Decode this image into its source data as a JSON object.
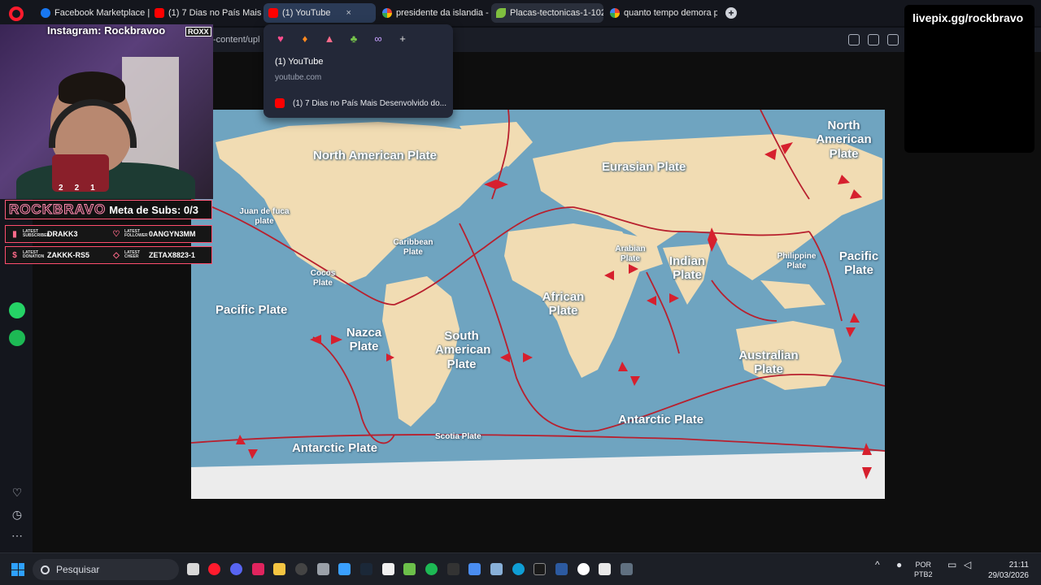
{
  "browser": {
    "tabs": [
      {
        "title": "Facebook Marketplace | Fa",
        "favicon": "facebook-icon"
      },
      {
        "title": "(1) 7 Dias no País Mais De",
        "favicon": "youtube-icon"
      },
      {
        "title": "(1) YouTube",
        "favicon": "youtube-icon",
        "active": true
      },
      {
        "title": "presidente da islandia - Pe",
        "favicon": "google-icon"
      },
      {
        "title": "Placas-tectonicas-1-1024x",
        "favicon": "leaf-icon"
      },
      {
        "title": "quanto tempo demora pa",
        "favicon": "google-icon"
      }
    ],
    "tab_close": "×",
    "new_tab": "+",
    "address_fragment": "-content/upl"
  },
  "tab_popup": {
    "emoji_icons": [
      "heart-icon",
      "fire-icon",
      "poop-icon",
      "palm-tree-icon",
      "glasses-icon"
    ],
    "add": "+",
    "title": "(1) YouTube",
    "url": "youtube.com",
    "item": "(1) 7 Dias no País Mais Desenvolvido do..."
  },
  "stream_overlay": {
    "instagram": "Instagram: Rockbravoo",
    "badge": "ROXX",
    "counters": [
      "2",
      "2",
      "1"
    ],
    "brand": "ROCKBRAVO",
    "goal": "Meta de Subs: 0/3",
    "stats": [
      {
        "label1": "LATEST SUBSCRIBER",
        "value1": "DRAKK3",
        "label2": "LATEST FOLLOWER",
        "value2": "0ANGYN3MM"
      },
      {
        "label1": "LATEST DONATION",
        "value1": "ZAKKK-RS5",
        "label2": "LATEST CHEER",
        "value2": "ZETAX8823-1"
      }
    ],
    "livepix": "livepix.gg/rockbravo"
  },
  "map": {
    "labels": [
      {
        "text": "North American Plate"
      },
      {
        "text": "Eurasian Plate"
      },
      {
        "text": "North American Plate"
      },
      {
        "text": "Juan de fuca plate"
      },
      {
        "text": "Caribbean Plate"
      },
      {
        "text": "Arabian Plate"
      },
      {
        "text": "Indian Plate"
      },
      {
        "text": "Philippine Plate"
      },
      {
        "text": "Pacific Plate"
      },
      {
        "text": "Cocos Plate"
      },
      {
        "text": "African Plate"
      },
      {
        "text": "Pacific Plate"
      },
      {
        "text": "Nazca Plate"
      },
      {
        "text": "South American Plate"
      },
      {
        "text": "Australian Plate"
      },
      {
        "text": "Antarctic Plate"
      },
      {
        "text": "Scotia Plate"
      },
      {
        "text": "Antarctic Plate"
      }
    ]
  },
  "taskbar": {
    "search_placeholder": "Pesquisar",
    "lang_top": "POR",
    "lang_bottom": "PTB2",
    "time": "21:11",
    "date": "29/03/2026"
  }
}
